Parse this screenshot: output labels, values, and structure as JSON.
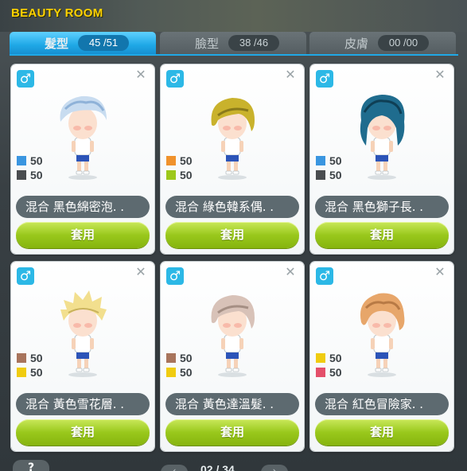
{
  "title": "BEAUTY ROOM",
  "tabs": [
    {
      "label": "髮型",
      "count": "45 /51"
    },
    {
      "label": "臉型",
      "count": "38 /46"
    },
    {
      "label": "皮膚",
      "count": "00 /00"
    }
  ],
  "cards": [
    {
      "gender": "♂",
      "name": "混合  黑色綿密泡. .",
      "apply": "套用",
      "color1": "#3a96e0",
      "value1": "50",
      "color2": "#4a4d50",
      "value2": "50",
      "hair_color": "#c8dcf0",
      "hair_shade": "#8fb2d8",
      "hair_style": "fluffy"
    },
    {
      "gender": "♂",
      "name": "混合  綠色韓系偶. .",
      "apply": "套用",
      "color1": "#f0922c",
      "value1": "50",
      "color2": "#9dc81a",
      "value2": "50",
      "hair_color": "#c9b22c",
      "hair_shade": "#8a7a1a",
      "hair_style": "side"
    },
    {
      "gender": "♂",
      "name": "混合  黑色獅子長. .",
      "apply": "套用",
      "color1": "#3a96e0",
      "value1": "50",
      "color2": "#4a4d50",
      "value2": "50",
      "hair_color": "#1f6c8e",
      "hair_shade": "#0f3f55",
      "hair_style": "long"
    },
    {
      "gender": "♂",
      "name": "混合  黃色雪花層. .",
      "apply": "套用",
      "color1": "#a8745c",
      "value1": "50",
      "color2": "#f0cc10",
      "value2": "50",
      "hair_color": "#f2df8e",
      "hair_shade": "#c9b25c",
      "hair_style": "spiky"
    },
    {
      "gender": "♂",
      "name": "混合  黃色達溫髮. .",
      "apply": "套用",
      "color1": "#a8745c",
      "value1": "50",
      "color2": "#f0cc10",
      "value2": "50",
      "hair_color": "#d8c2b8",
      "hair_shade": "#a58f84",
      "hair_style": "side"
    },
    {
      "gender": "♂",
      "name": "混合  紅色冒險家. .",
      "apply": "套用",
      "color1": "#f0cc10",
      "value1": "50",
      "color2": "#e4506a",
      "value2": "50",
      "hair_color": "#e7a66a",
      "hair_shade": "#b87a45",
      "hair_style": "wavy"
    }
  ],
  "pager": {
    "prev": "‹",
    "next": "›",
    "text": "02 / 34"
  },
  "help": "?"
}
